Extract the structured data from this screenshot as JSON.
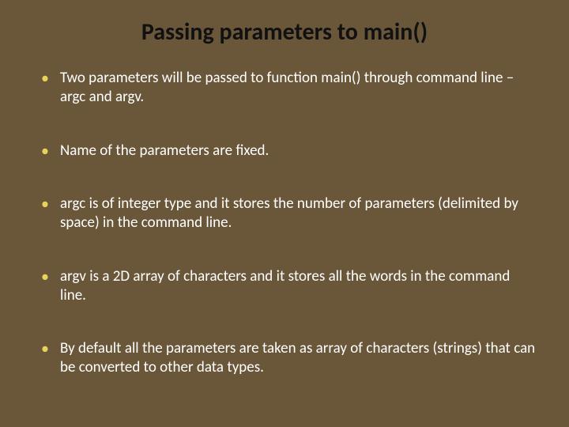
{
  "slide": {
    "title": "Passing parameters to main()",
    "bullets": [
      "Two parameters will be passed to function main() through command line – argc and argv.",
      "Name of the parameters are fixed.",
      "argc is of integer type and it stores the number of parameters (delimited by space) in the command line.",
      "argv is a 2D array of characters and it stores all the words in the command line.",
      "By default all the parameters are taken as array of characters (strings) that can be converted to other data types."
    ]
  }
}
